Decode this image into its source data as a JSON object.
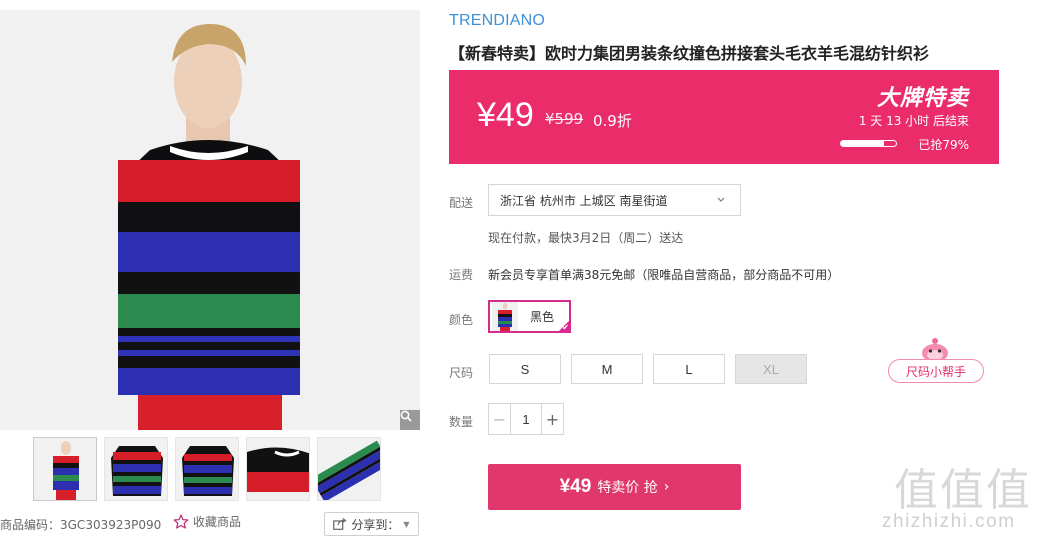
{
  "gallery": {
    "main_image": "sweater-model-photo",
    "thumbnails": [
      "model-front",
      "sweater-front",
      "sweater-back",
      "sweater-detail",
      "sweater-sleeve"
    ],
    "item_code": "商品编码：3GC303923P090",
    "favorite_label": "收藏商品",
    "share_label": "分享到："
  },
  "product": {
    "brand": "TRENDIANO",
    "title": "【新春特卖】欧时力集团男装条纹撞色拼接套头毛衣羊毛混纺针织衫"
  },
  "price": {
    "current": "¥49",
    "original": "¥599",
    "discount": "0.9折",
    "flash_label": "大牌特卖",
    "countdown": "1  天  13  小时 后结束",
    "sold_progress": 0.79,
    "sold_text": "已抢79%",
    "banner_color": "#ea2d6a"
  },
  "delivery": {
    "label": "配送",
    "region": "浙江省 杭州市 上城区 南星街道",
    "note": "现在付款，最快3月2日（周二）送达"
  },
  "shipping": {
    "label": "运费",
    "text": "新会员专享首单满38元免邮（限唯品自营商品，部分商品不可用）"
  },
  "color": {
    "label": "颜色",
    "options": [
      {
        "name": "黑色",
        "selected": true
      }
    ]
  },
  "size": {
    "label": "尺码",
    "options": [
      {
        "name": "S",
        "available": true
      },
      {
        "name": "M",
        "available": true
      },
      {
        "name": "L",
        "available": true
      },
      {
        "name": "XL",
        "available": false
      }
    ],
    "helper_label": "尺码小帮手"
  },
  "quantity": {
    "label": "数量",
    "value": "1",
    "minus": "−",
    "plus": "+"
  },
  "buy": {
    "price": "¥49",
    "label": "特卖价 抢",
    "arrow": "›",
    "color": "#e0386c"
  },
  "watermark": {
    "glyphs": "值值值",
    "text": "zhizhizhi.com"
  }
}
